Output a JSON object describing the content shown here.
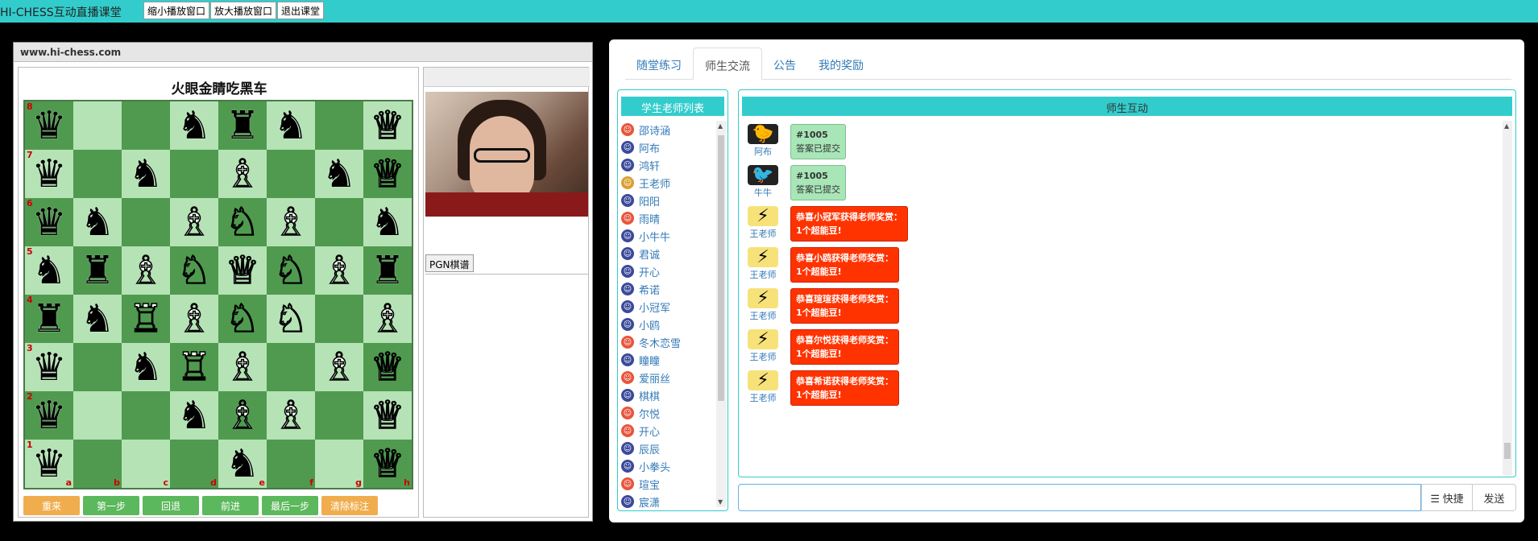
{
  "topbar": {
    "title": "HI-CHESS互动直播课堂",
    "buttons": [
      "缩小播放窗口",
      "放大播放窗口",
      "退出课堂"
    ]
  },
  "board_panel": {
    "site": "www.hi-chess.com",
    "puzzle_title": "火眼金睛吃黑车",
    "ranks": [
      "8",
      "7",
      "6",
      "5",
      "4",
      "3",
      "2",
      "1"
    ],
    "files": [
      "a",
      "b",
      "c",
      "d",
      "e",
      "f",
      "g",
      "h"
    ],
    "board": [
      [
        "bq",
        "",
        "",
        "bn",
        "br",
        "bn",
        "",
        "wq"
      ],
      [
        "bq",
        "",
        "bn",
        "",
        "wb",
        "",
        "bn",
        "wq"
      ],
      [
        "bq",
        "bn",
        "",
        "wb",
        "wn",
        "wb",
        "",
        "bn"
      ],
      [
        "bn",
        "br",
        "wb",
        "wn",
        "wq",
        "wn",
        "wb",
        "br"
      ],
      [
        "br",
        "bn",
        "wr",
        "wb",
        "wn",
        "wn",
        "",
        "wb"
      ],
      [
        "bq",
        "",
        "bn",
        "wr",
        "wb",
        "",
        "wb",
        "wq"
      ],
      [
        "bq",
        "",
        "",
        "bn",
        "wb",
        "wb",
        "",
        "wq"
      ],
      [
        "bq",
        "",
        "",
        "",
        "bn",
        "",
        "",
        "wq"
      ]
    ],
    "controls": [
      {
        "label": "重来",
        "color": "#f0ad4e"
      },
      {
        "label": "第一步",
        "color": "#5cb85c"
      },
      {
        "label": "回退",
        "color": "#5cb85c"
      },
      {
        "label": "前进",
        "color": "#5cb85c"
      },
      {
        "label": "最后一步",
        "color": "#5cb85c"
      },
      {
        "label": "清除标注",
        "color": "#f0ad4e"
      }
    ],
    "pgn_tab": "PGN棋谱"
  },
  "tabs": [
    {
      "label": "随堂练习",
      "active": false
    },
    {
      "label": "师生交流",
      "active": true
    },
    {
      "label": "公告",
      "active": false
    },
    {
      "label": "我的奖励",
      "active": false
    }
  ],
  "user_list": {
    "title": "学生老师列表",
    "users": [
      {
        "name": "邵诗涵",
        "type": "girl"
      },
      {
        "name": "阿布",
        "type": "boy"
      },
      {
        "name": "鸿轩",
        "type": "boy"
      },
      {
        "name": "王老师",
        "type": "teacher"
      },
      {
        "name": "阳阳",
        "type": "boy"
      },
      {
        "name": "雨晴",
        "type": "girl"
      },
      {
        "name": "小牛牛",
        "type": "boy"
      },
      {
        "name": "君诚",
        "type": "boy"
      },
      {
        "name": "开心",
        "type": "boy"
      },
      {
        "name": "希诺",
        "type": "boy"
      },
      {
        "name": "小冠军",
        "type": "boy"
      },
      {
        "name": "小鸥",
        "type": "boy"
      },
      {
        "name": "冬木恋雪",
        "type": "girl"
      },
      {
        "name": "瞳瞳",
        "type": "boy"
      },
      {
        "name": "爱丽丝",
        "type": "girl"
      },
      {
        "name": "棋棋",
        "type": "boy"
      },
      {
        "name": "尔悦",
        "type": "girl"
      },
      {
        "name": "开心",
        "type": "girl"
      },
      {
        "name": "辰辰",
        "type": "boy"
      },
      {
        "name": "小拳头",
        "type": "boy"
      },
      {
        "name": "瑄宝",
        "type": "girl"
      },
      {
        "name": "宸潇",
        "type": "boy"
      }
    ]
  },
  "chat": {
    "title": "师生互动",
    "messages": [
      {
        "sender": "阿布",
        "avatar": "yellow-bird-icon",
        "line1": "#1005",
        "line2": "答案已提交",
        "style": "green"
      },
      {
        "sender": "牛牛",
        "avatar": "white-bird-icon",
        "line1": "#1005",
        "line2": "答案已提交",
        "style": "green"
      },
      {
        "sender": "王老师",
        "avatar": "pikachu-icon",
        "line1": "恭喜小冠军获得老师奖赏：",
        "line2": "1个超能豆!",
        "style": "red"
      },
      {
        "sender": "王老师",
        "avatar": "pikachu-icon",
        "line1": "恭喜小鸥获得老师奖赏：",
        "line2": "1个超能豆!",
        "style": "red"
      },
      {
        "sender": "王老师",
        "avatar": "pikachu-icon",
        "line1": "恭喜瑄瑄获得老师奖赏：",
        "line2": "1个超能豆!",
        "style": "red"
      },
      {
        "sender": "王老师",
        "avatar": "pikachu-icon",
        "line1": "恭喜尔悦获得老师奖赏：",
        "line2": "1个超能豆!",
        "style": "red"
      },
      {
        "sender": "王老师",
        "avatar": "pikachu-icon",
        "line1": "恭喜希诺获得老师奖赏：",
        "line2": "1个超能豆!",
        "style": "red"
      }
    ],
    "input_value": "",
    "quick_label": "☰ 快捷",
    "send_label": "发送"
  }
}
